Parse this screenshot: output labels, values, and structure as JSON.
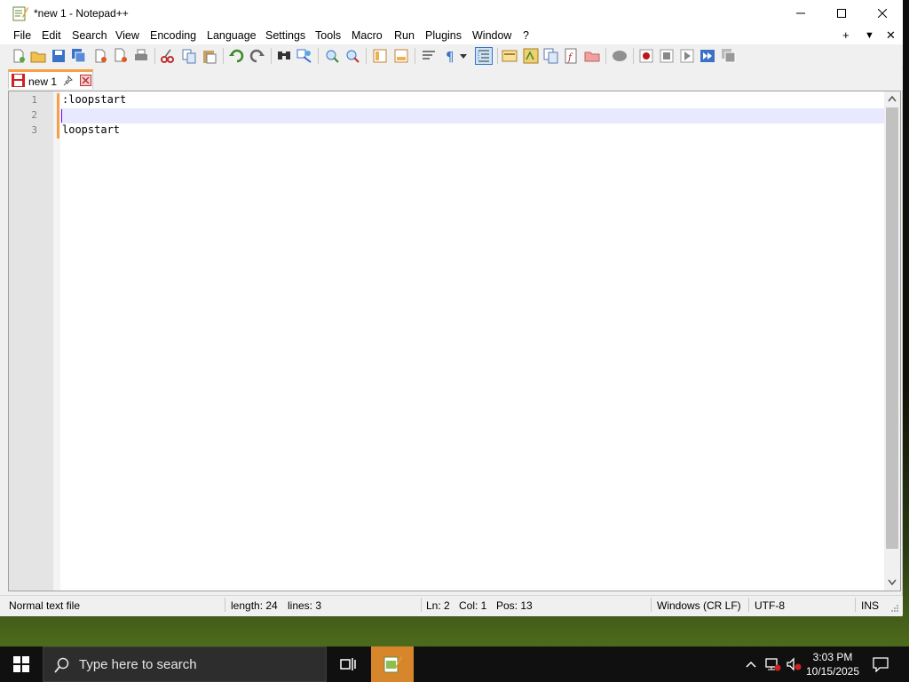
{
  "window": {
    "title": "*new 1 - Notepad++"
  },
  "menu": {
    "items": [
      "File",
      "Edit",
      "Search",
      "View",
      "Encoding",
      "Language",
      "Settings",
      "Tools",
      "Macro",
      "Run",
      "Plugins",
      "Window",
      "?"
    ],
    "right_plus": "+",
    "right_down": "▼",
    "right_close": "✕"
  },
  "tab": {
    "label": "new 1"
  },
  "editor": {
    "line_numbers": [
      "1",
      "2",
      "3"
    ],
    "lines": [
      ":loopstart",
      "",
      "loopstart"
    ],
    "current_line_color": "#e8e8ff",
    "change_bar_color": "#f7a048"
  },
  "status": {
    "file_type": "Normal text file",
    "length": "length: 24",
    "lines": "lines: 3",
    "ln": "Ln: 2",
    "col": "Col: 1",
    "pos": "Pos: 13",
    "eol": "Windows (CR LF)",
    "encoding": "UTF-8",
    "mode": "INS"
  },
  "taskbar": {
    "search_placeholder": "Type here to search",
    "time": "3:03 PM",
    "date": "10/15/2025"
  }
}
